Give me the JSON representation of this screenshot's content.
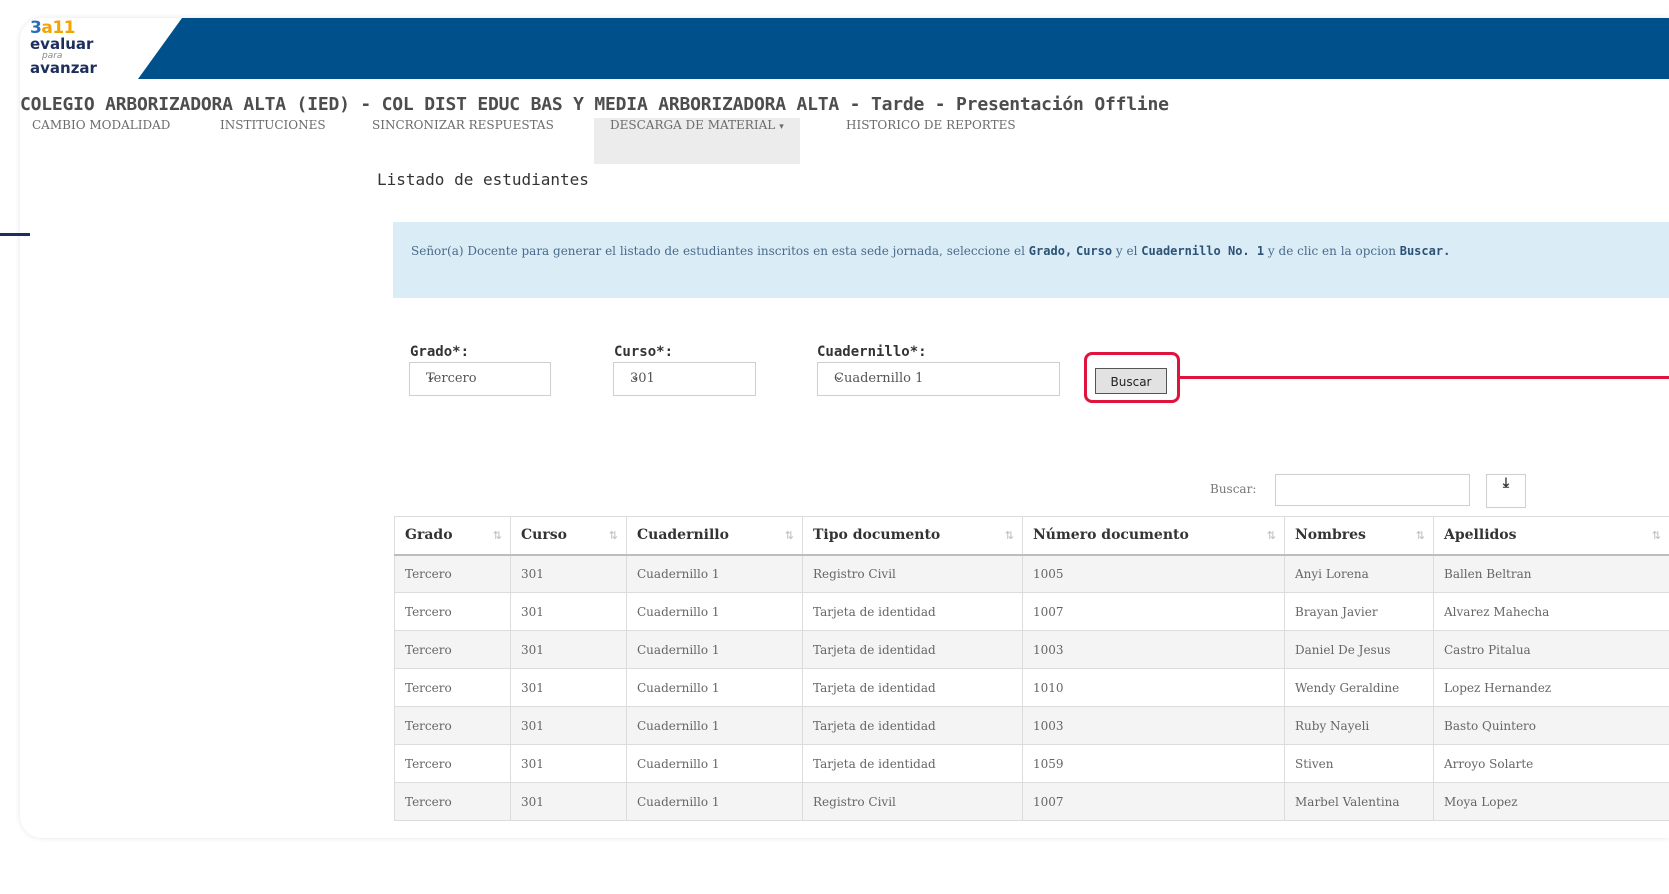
{
  "logo": {
    "line1_a": "3",
    "line1_b": "a",
    "line1_c": "11",
    "line2": "evaluar",
    "line3": "para",
    "line4": "avanzar"
  },
  "school_title": "COLEGIO ARBORIZADORA ALTA (IED) - COL DIST EDUC BAS Y MEDIA ARBORIZADORA ALTA - Tarde - Presentación Offline",
  "nav": {
    "items": [
      {
        "label": "CAMBIO MODALIDAD"
      },
      {
        "label": "INSTITUCIONES"
      },
      {
        "label": "SINCRONIZAR RESPUESTAS"
      },
      {
        "label": "DESCARGA DE MATERIAL"
      },
      {
        "label": "HISTORICO DE REPORTES"
      }
    ],
    "caret": "▾"
  },
  "section_title": "Listado de estudiantes",
  "info": {
    "part1": "Señor(a) Docente para generar el listado de estudiantes inscritos en esta sede jornada, seleccione el ",
    "b1": "Grado,",
    "b2": "Curso",
    "part2": " y el ",
    "b3": "Cuadernillo No. 1",
    "part3": " y de clic en la opcion ",
    "b4": "Buscar."
  },
  "filters": {
    "grado": {
      "label": "Grado*:",
      "value": "Tercero"
    },
    "curso": {
      "label": "Curso*:",
      "value": "301"
    },
    "cuadernillo": {
      "label": "Cuadernillo*:",
      "value": "Cuadernillo 1"
    },
    "arrow": "⌄",
    "buscar_button": "Buscar"
  },
  "search": {
    "label": "Buscar:",
    "value": "",
    "download_icon": "⤓"
  },
  "table": {
    "headers": [
      "Grado",
      "Curso",
      "Cuadernillo",
      "Tipo documento",
      "Número documento",
      "Nombres",
      "Apellidos"
    ],
    "sort_icons": [
      "⇅",
      "⇅",
      "⇅",
      "⇅",
      "⇅",
      "⇅",
      "⇅"
    ],
    "rows": [
      [
        "Tercero",
        "301",
        "Cuadernillo 1",
        "Registro Civil",
        "1005",
        "Anyi Lorena",
        "Ballen Beltran"
      ],
      [
        "Tercero",
        "301",
        "Cuadernillo 1",
        "Tarjeta de identidad",
        "1007",
        "Brayan Javier",
        "Alvarez Mahecha"
      ],
      [
        "Tercero",
        "301",
        "Cuadernillo 1",
        "Tarjeta de identidad",
        "1003",
        "Daniel De Jesus",
        "Castro Pitalua"
      ],
      [
        "Tercero",
        "301",
        "Cuadernillo 1",
        "Tarjeta de identidad",
        "1010",
        "Wendy Geraldine",
        "Lopez Hernandez"
      ],
      [
        "Tercero",
        "301",
        "Cuadernillo 1",
        "Tarjeta de identidad",
        "1003",
        "Ruby Nayeli",
        "Basto Quintero"
      ],
      [
        "Tercero",
        "301",
        "Cuadernillo 1",
        "Tarjeta de identidad",
        "1059",
        "Stiven",
        "Arroyo Solarte"
      ],
      [
        "Tercero",
        "301",
        "Cuadernillo 1",
        "Registro Civil",
        "1007",
        "Marbel Valentina",
        "Moya Lopez"
      ]
    ]
  },
  "colors": {
    "brand_blue": "#00518b",
    "highlight_red": "#e0133e",
    "info_bg": "#daedf7"
  }
}
